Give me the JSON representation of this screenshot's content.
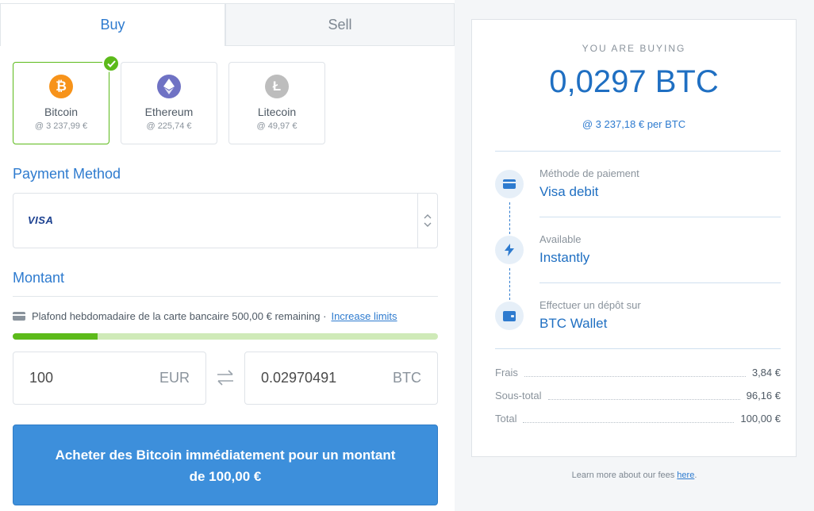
{
  "tabs": {
    "buy": "Buy",
    "sell": "Sell"
  },
  "coins": [
    {
      "name": "Bitcoin",
      "price": "@ 3 237,99 €",
      "glyph": "₿",
      "color": "#f7931a",
      "selected": true
    },
    {
      "name": "Ethereum",
      "price": "@ 225,74 €",
      "glyph": "◆",
      "color": "#6f72c4",
      "selected": false
    },
    {
      "name": "Litecoin",
      "price": "@ 49,97 €",
      "glyph": "Ł",
      "color": "#bdbdbd",
      "selected": false
    }
  ],
  "payment": {
    "title": "Payment Method",
    "card_brand": "VISA"
  },
  "amount": {
    "title": "Montant",
    "limit_text": "Plafond hebdomadaire de la carte bancaire 500,00 € remaining ·",
    "increase_link": "Increase limits",
    "limit_used_fraction": 0.2,
    "fiat_value": "100",
    "fiat_currency": "EUR",
    "crypto_value": "0.02970491",
    "crypto_currency": "BTC"
  },
  "buy_button": {
    "line1": "Acheter des Bitcoin immédiatement pour un montant",
    "line2": "de 100,00 €"
  },
  "summary": {
    "heading": "YOU ARE BUYING",
    "amount": "0,0297 BTC",
    "rate": "@ 3 237,18 € per BTC",
    "steps": [
      {
        "label": "Méthode de paiement",
        "value": "Visa debit",
        "icon": "card-icon"
      },
      {
        "label": "Available",
        "value": "Instantly",
        "icon": "lightning-icon"
      },
      {
        "label": "Effectuer un dépôt sur",
        "value": "BTC Wallet",
        "icon": "wallet-icon"
      }
    ],
    "fees": [
      {
        "label": "Frais",
        "value": "3,84 €"
      },
      {
        "label": "Sous-total",
        "value": "96,16 €"
      },
      {
        "label": "Total",
        "value": "100,00 €"
      }
    ]
  },
  "footer": {
    "text": "Learn more about our fees",
    "link": "here",
    "suffix": "."
  },
  "colors": {
    "accent": "#2e7bcf",
    "button": "#3d8fdb",
    "success": "#5cba1a"
  }
}
